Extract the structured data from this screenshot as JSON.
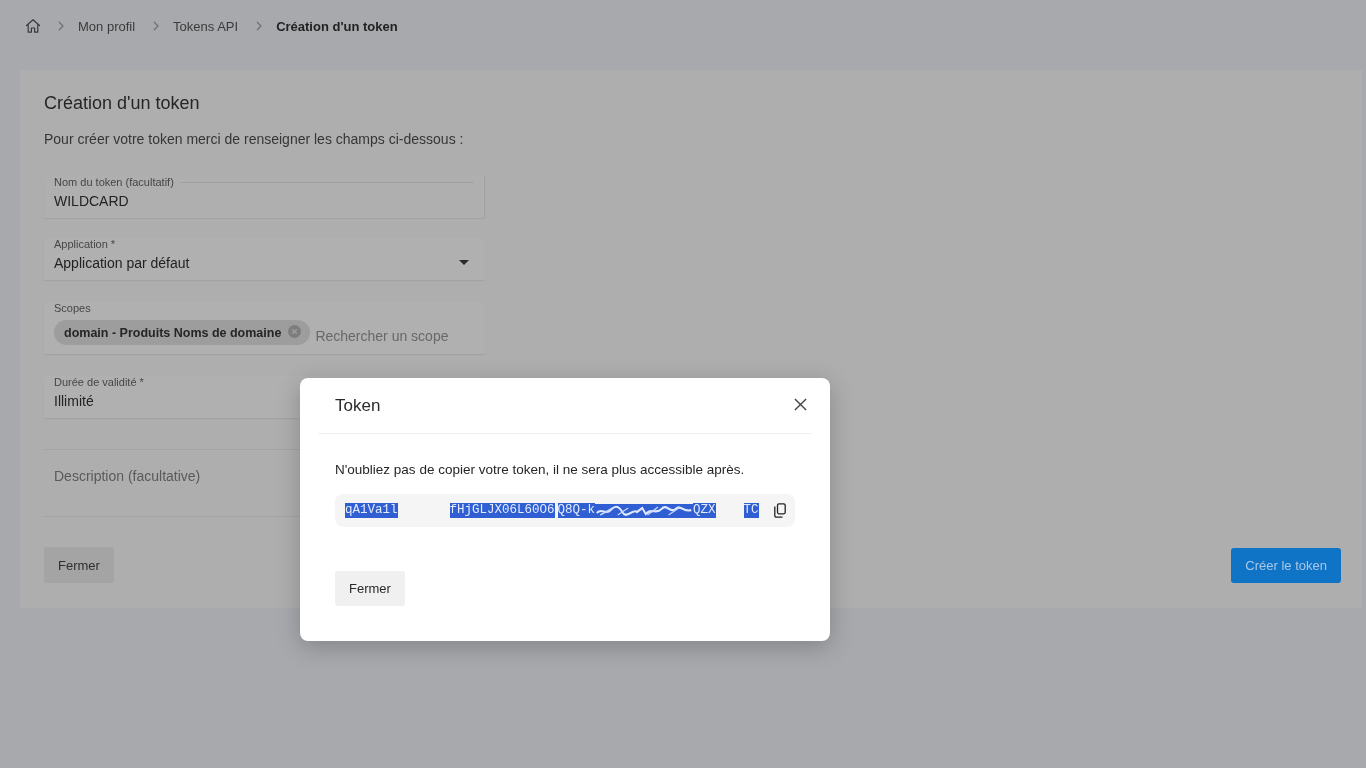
{
  "breadcrumb": [
    {
      "label": "Mon profil",
      "current": false
    },
    {
      "label": "Tokens API",
      "current": false
    },
    {
      "label": "Création d'un token",
      "current": true
    }
  ],
  "form": {
    "title": "Création d'un token",
    "intro": "Pour créer votre token merci de renseigner les champs ci-dessous :",
    "fields": [
      {
        "kind": "text",
        "label": "Nom du token (facultatif)",
        "value": "WILDCARD",
        "focused": true
      },
      {
        "kind": "select",
        "label": "Application *",
        "value": "Application par défaut",
        "focused": false
      },
      {
        "kind": "chips",
        "label": "Scopes",
        "chips": [
          "domain - Produits Noms de domaine"
        ],
        "placeholder": "Rechercher un scope",
        "focused": false
      },
      {
        "kind": "text",
        "label": "Durée de validité *",
        "value": "Illimité",
        "focused": false
      },
      {
        "kind": "textarea",
        "placeholder": "Description (facultative)",
        "focused": false
      }
    ],
    "buttons": [
      {
        "kind": "secondary",
        "label": "Fermer"
      },
      {
        "kind": "primary",
        "label": "Créer le token"
      }
    ]
  },
  "dialog": {
    "title": "Token",
    "message": "N'oubliez pas de copier votre token, il ne sera plus accessible après.",
    "token": {
      "selected": true,
      "parts": [
        {
          "kind": "text",
          "text": "qA1Va1l"
        },
        {
          "kind": "gap"
        },
        {
          "kind": "text",
          "text": "fHjGLJX06L60O6"
        },
        {
          "kind": "text",
          "text": "Q8Q-k"
        },
        {
          "kind": "scribble"
        },
        {
          "kind": "text",
          "text": "QZX"
        },
        {
          "kind": "gap"
        },
        {
          "kind": "text",
          "text": "TC"
        }
      ]
    },
    "buttons": [
      "Fermer"
    ]
  }
}
